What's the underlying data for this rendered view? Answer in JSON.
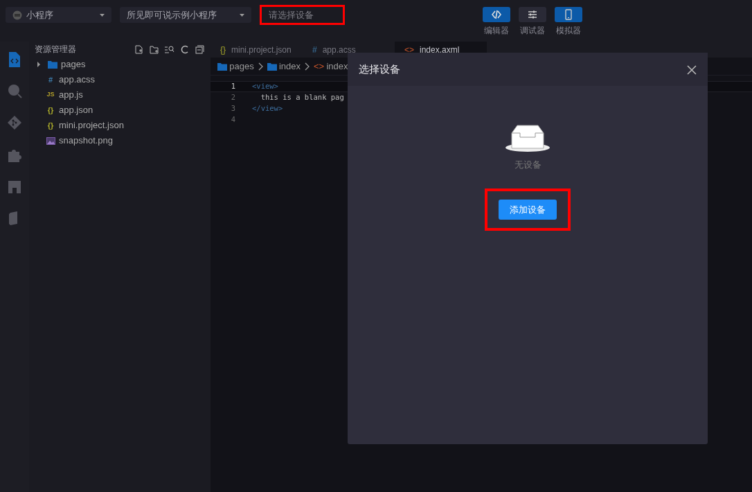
{
  "toolbar": {
    "app_type": "小程序",
    "project": "所见即可说示例小程序",
    "device_field": {
      "placeholder": "请选择设备",
      "highlighted": true
    },
    "views": [
      {
        "label": "编辑器",
        "kind": "editor",
        "on": true
      },
      {
        "label": "调试器",
        "kind": "debugger",
        "on": false
      },
      {
        "label": "模拟器",
        "kind": "simulator",
        "on": true
      }
    ]
  },
  "activity_bar": [
    {
      "kind": "files",
      "selected": true
    },
    {
      "kind": "search",
      "selected": false
    },
    {
      "kind": "git",
      "selected": false
    },
    {
      "kind": "extensions",
      "selected": false
    },
    {
      "kind": "store",
      "selected": false
    },
    {
      "kind": "docs",
      "selected": false
    }
  ],
  "explorer": {
    "title": "资源管理器",
    "files": [
      {
        "name": "pages",
        "kind": "folder",
        "expanded": false
      },
      {
        "name": "app.acss",
        "kind": "css",
        "icon": "#"
      },
      {
        "name": "app.js",
        "kind": "js",
        "icon": "JS"
      },
      {
        "name": "app.json",
        "kind": "json",
        "icon": "{}"
      },
      {
        "name": "mini.project.json",
        "kind": "json",
        "icon": "{}"
      },
      {
        "name": "snapshot.png",
        "kind": "image"
      }
    ]
  },
  "editor": {
    "tabs": [
      {
        "label": "mini.project.json",
        "kind": "json",
        "icon": "{}",
        "selected": false
      },
      {
        "label": "app.acss",
        "kind": "css",
        "icon": "#",
        "selected": false
      },
      {
        "label": "index.axml",
        "kind": "xml",
        "icon": "<>",
        "selected": true
      }
    ],
    "breadcrumb": [
      {
        "label": "pages",
        "kind": "folder"
      },
      {
        "label": "index",
        "kind": "folder"
      },
      {
        "label": "index",
        "kind": "xml",
        "icon": "<>"
      }
    ],
    "lines": [
      {
        "number": "1",
        "current": true,
        "tokens": [
          {
            "text": "<view>",
            "kind": "tag"
          }
        ]
      },
      {
        "number": "2",
        "current": false,
        "tokens": [
          {
            "text": "  this is a blank pag",
            "kind": "text"
          }
        ]
      },
      {
        "number": "3",
        "current": false,
        "tokens": [
          {
            "text": "</view>",
            "kind": "tag"
          }
        ]
      },
      {
        "number": "4",
        "current": false
      }
    ]
  },
  "dialog": {
    "title": "选择设备",
    "empty_text": "无设备",
    "add_button": {
      "label": "添加设备",
      "highlighted": true
    }
  }
}
